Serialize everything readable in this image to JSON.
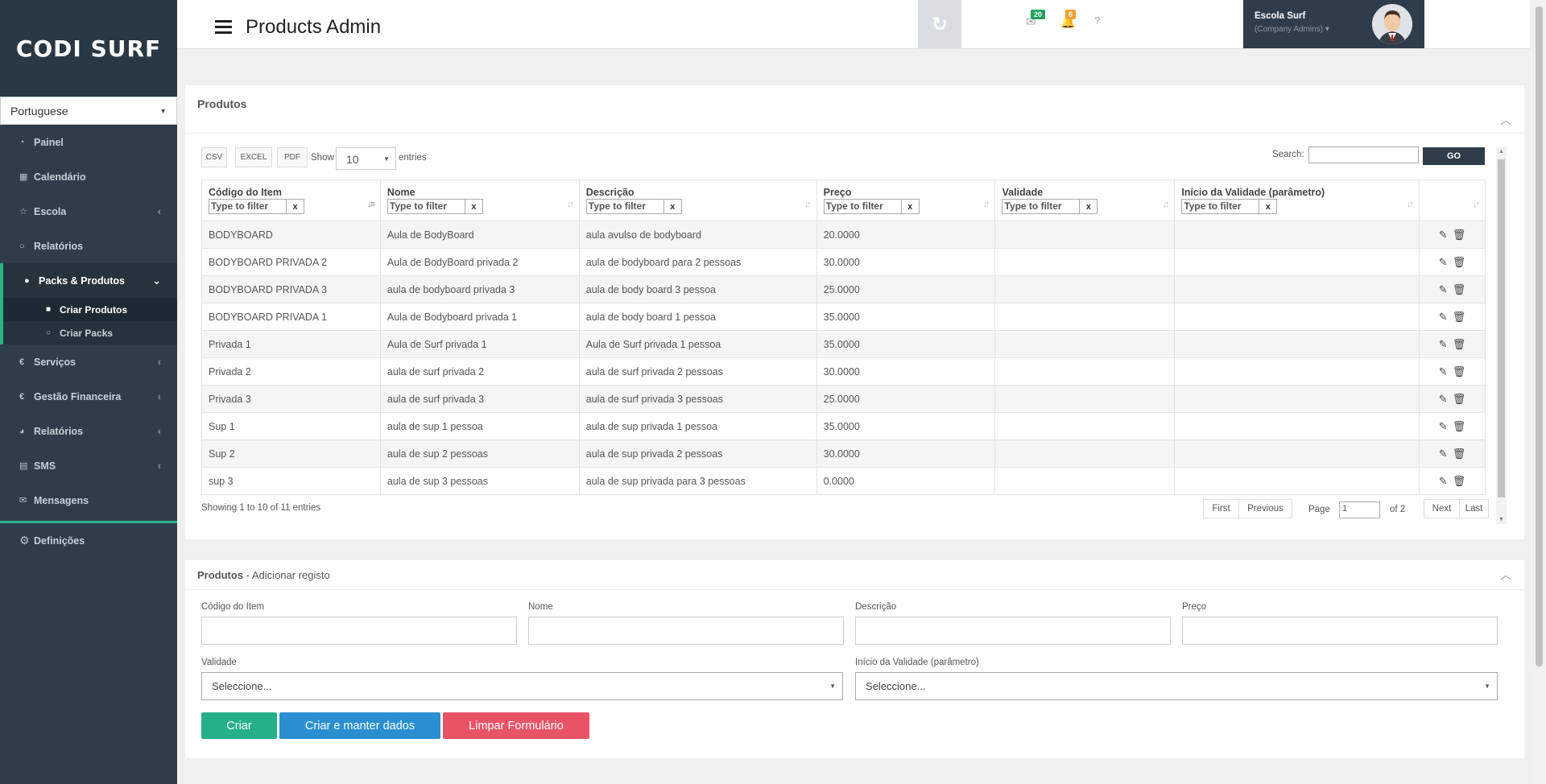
{
  "app": {
    "logo": "CODI SURF",
    "page_title": "Products Admin",
    "language": "Portuguese"
  },
  "sidebar": {
    "items": [
      {
        "label": "Painel",
        "icon": "dashboard-icon"
      },
      {
        "label": "Calendário",
        "icon": "calendar-icon"
      },
      {
        "label": "Escola",
        "icon": "star-icon"
      },
      {
        "label": "Relatórios",
        "icon": "circle-icon"
      },
      {
        "label": "Packs & Produtos",
        "icon": "check-circle-icon"
      },
      {
        "label": "Serviços",
        "icon": "euro-icon"
      },
      {
        "label": "Gestão Financeira",
        "icon": "euro-icon"
      },
      {
        "label": "Relatórios",
        "icon": "pie-chart-icon"
      },
      {
        "label": "SMS",
        "icon": "document-icon"
      },
      {
        "label": "Mensagens",
        "icon": "envelope-icon"
      },
      {
        "label": "Definições",
        "icon": "gear-icon"
      }
    ],
    "submenu": [
      {
        "label": "Criar Produtos"
      },
      {
        "label": "Criar Packs"
      }
    ]
  },
  "header": {
    "messages_count": "20",
    "notifications_count": "6",
    "user_name": "Escola Surf",
    "user_role": "(Company Admins)"
  },
  "products_panel": {
    "title": "Produtos",
    "buttons": {
      "csv": "CSV",
      "excel": "EXCEL",
      "pdf": "PDF"
    },
    "show_label": "Show",
    "show_value": "10",
    "entries_label": "entries",
    "search_label": "Search:",
    "go_label": "GO",
    "filter_placeholder": "Type to filter",
    "filter_clear": "x",
    "columns": [
      "Código do Item",
      "Nome",
      "Descrição",
      "Preço",
      "Validade",
      "Início da Validade (parâmetro)"
    ],
    "rows": [
      [
        "BODYBOARD",
        "Aula de BodyBoard",
        "aula avulso de bodyboard",
        "20.0000",
        "",
        ""
      ],
      [
        "BODYBOARD PRIVADA 2",
        "Aula de BodyBoard privada 2",
        "aula de bodyboard para 2 pessoas",
        "30.0000",
        "",
        ""
      ],
      [
        "BODYBOARD PRIVADA 3",
        "aula de bodyboard privada 3",
        "aula de body board 3 pessoa",
        "25.0000",
        "",
        ""
      ],
      [
        "BODYBOARD PRIVADA 1",
        "Aula de Bodyboard privada 1",
        "aula de body board 1 pessoa",
        "35.0000",
        "",
        ""
      ],
      [
        "Privada 1",
        "Aula de Surf privada 1",
        "Aula de Surf privada 1 pessoa",
        "35.0000",
        "",
        ""
      ],
      [
        "Privada 2",
        "aula de surf privada 2",
        "aula de surf privada 2 pessoas",
        "30.0000",
        "",
        ""
      ],
      [
        "Privada 3",
        "aula de surf privada 3",
        "aula de surf privada 3 pessoas",
        "25.0000",
        "",
        ""
      ],
      [
        "Sup 1",
        "aula de sup 1 pessoa",
        "aula de sup privada 1 pessoa",
        "35.0000",
        "",
        ""
      ],
      [
        "Sup 2",
        "aula de sup 2 pessoas",
        "aula de sup privada 2 pessoas",
        "30.0000",
        "",
        ""
      ],
      [
        "sup 3",
        "aula de sup 3 pessoas",
        "aula de sup privada para 3 pessoas",
        "0.0000",
        "",
        ""
      ]
    ],
    "info": "Showing 1 to 10 of 11 entries",
    "pagination": {
      "first": "First",
      "previous": "Previous",
      "page_label": "Page",
      "page_value": "1",
      "of_label": "of 2",
      "next": "Next",
      "last": "Last"
    }
  },
  "form_panel": {
    "title_bold": "Produtos",
    "title_rest": " - Adicionar registo",
    "fields": {
      "codigo": "Código do Item",
      "nome": "Nome",
      "descricao": "Descrição",
      "preco": "Preço",
      "validade": "Validade",
      "inicio": "Início da Validade (parâmetro)"
    },
    "select_placeholder": "Seleccione...",
    "buttons": {
      "criar": "Criar",
      "criar_manter": "Criar e manter dados",
      "limpar": "Limpar Formulário"
    }
  },
  "colors": {
    "sidebar_bg": "#2f3d4a",
    "accent_green": "#2bb38a",
    "btn_green": "#26b08a",
    "btn_blue": "#2a8fd1",
    "btn_red": "#e85466",
    "badge_green": "#1fa35a",
    "badge_orange": "#f0a030"
  }
}
